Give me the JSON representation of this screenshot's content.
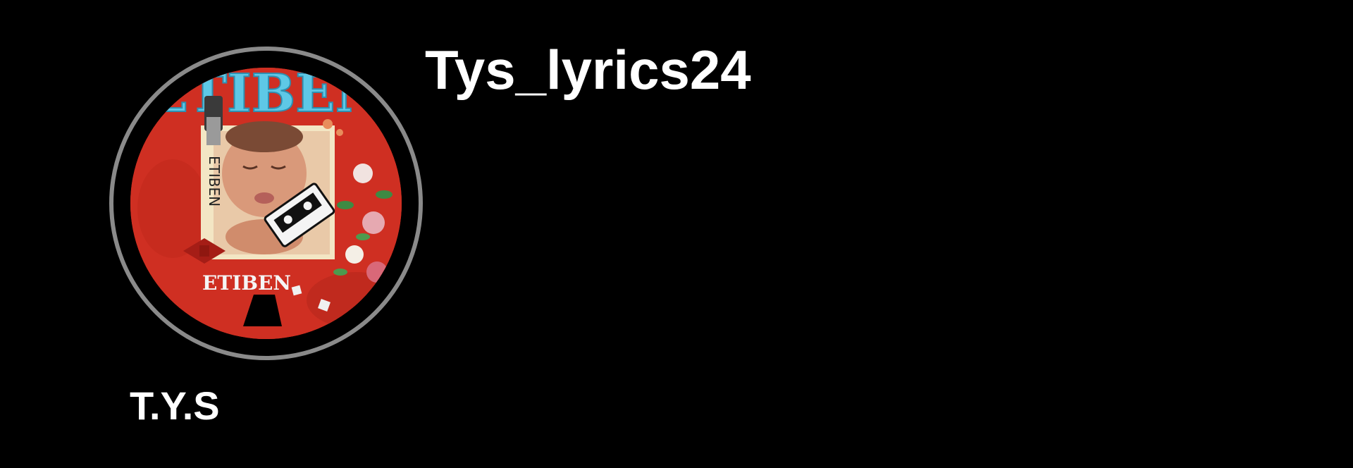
{
  "profile": {
    "username": "Tys_lyrics24",
    "display_name": "T.Y.S",
    "avatar": {
      "icon": "album-cover-avatar",
      "cover_title": "ETIBEN",
      "cover_side_text": "ETIBEN",
      "cover_bottom_text": "ETIBEN",
      "colors": {
        "background": "#cf2f22",
        "title": "#5ec8e6",
        "ring": "#8a8a8a"
      }
    }
  }
}
